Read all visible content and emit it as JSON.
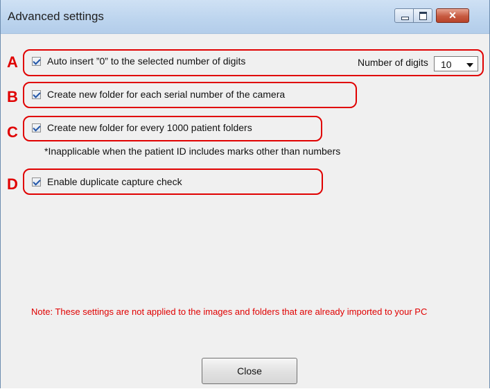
{
  "window": {
    "title": "Advanced settings",
    "controls": {
      "minimize": "minimize-icon",
      "maximize": "maximize-icon",
      "close": "close-icon"
    }
  },
  "options": [
    {
      "marker": "A",
      "checked": true,
      "label": "Auto insert ”0” to the selected number of digits",
      "extra": {
        "label": "Number of digits",
        "value": "10"
      }
    },
    {
      "marker": "B",
      "checked": true,
      "label": "Create new folder for each serial number of the camera"
    },
    {
      "marker": "C",
      "checked": true,
      "label": "Create new folder for every 1000 patient folders",
      "hint": "*Inapplicable when the patient ID includes marks other than numbers"
    },
    {
      "marker": "D",
      "checked": true,
      "label": "Enable duplicate capture check"
    }
  ],
  "note": "Note: These settings are not applied to the images and folders that are already imported to your PC",
  "close_button": "Close",
  "colors": {
    "annotation": "#e00000",
    "note_text": "#e00000",
    "checkmark": "#2155a7"
  }
}
